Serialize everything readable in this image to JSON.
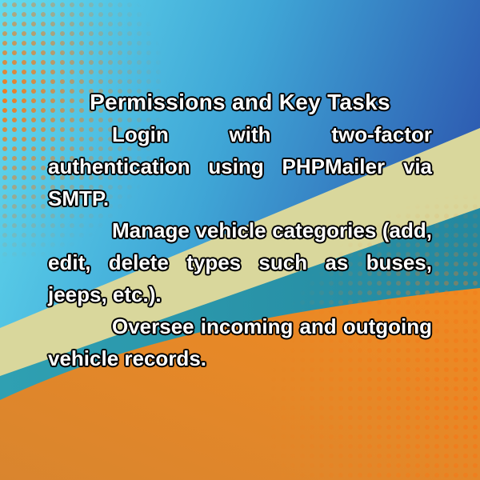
{
  "colors": {
    "cyan": "#5bd4e8",
    "blue": "#2f5fb3",
    "beige": "#d8d69a",
    "teal": "#2a96a8",
    "orange": "#e58a2a",
    "dot_orange": "#f07a1c",
    "text": "#ffffff",
    "outline": "#000000"
  },
  "title": "Permissions and Key Tasks",
  "tasks": [
    "Login with two-factor authentication using PHPMailer via SMTP.",
    "Manage vehicle categories (add, edit, delete types such as buses, jeeps, etc.).",
    "Oversee incoming and outgoing vehicle records."
  ]
}
